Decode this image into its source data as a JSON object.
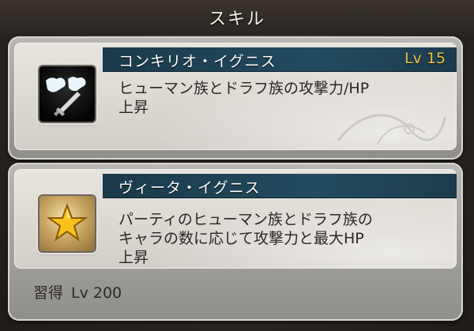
{
  "header": {
    "title": "スキル"
  },
  "skills": [
    {
      "name": "コンキリオ・イグニス",
      "level": "Lv 15",
      "description": "ヒューマン族とドラフ族の攻撃力/HP\n上昇",
      "icon": "fists-sword-icon"
    },
    {
      "name": "ヴィータ・イグニス",
      "description": "パーティのヒューマン族とドラフ族の\nキャラの数に応じて攻撃力と最大HP\n上昇",
      "icon": "gold-star-icon",
      "learn_label": "習得",
      "learn_level": "Lv 200"
    }
  ],
  "colors": {
    "header_band": "#224b60",
    "level_text": "#e8c34a",
    "card_bg": "#e8e5df"
  }
}
